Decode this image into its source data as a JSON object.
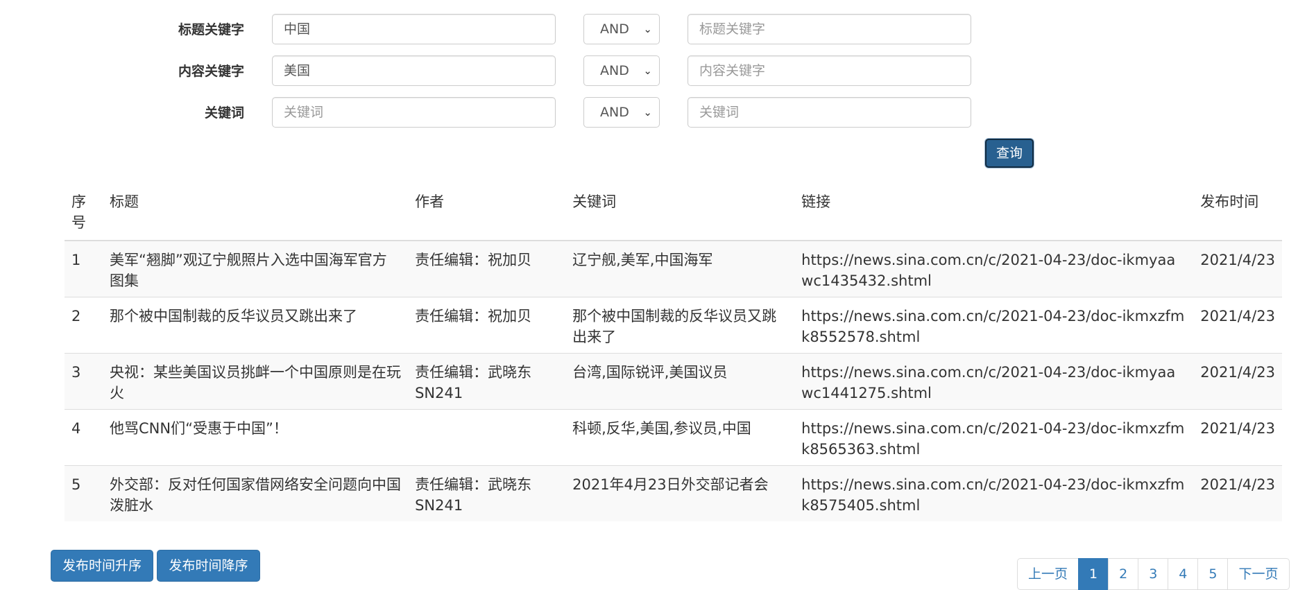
{
  "search": {
    "rows": [
      {
        "label": "标题关键字",
        "value1": "中国",
        "placeholder1": "标题关键字",
        "operator": "AND",
        "value2": "",
        "placeholder2": "标题关键字"
      },
      {
        "label": "内容关键字",
        "value1": "美国",
        "placeholder1": "内容关键字",
        "operator": "AND",
        "value2": "",
        "placeholder2": "内容关键字"
      },
      {
        "label": "关键词",
        "value1": "",
        "placeholder1": "关键词",
        "operator": "AND",
        "value2": "",
        "placeholder2": "关键词"
      }
    ],
    "query_label": "查询"
  },
  "table": {
    "headers": [
      "序号",
      "标题",
      "作者",
      "关键词",
      "链接",
      "发布时间"
    ],
    "rows": [
      {
        "idx": "1",
        "title": "美军“翘脚”观辽宁舰照片入选中国海军官方图集",
        "author": "责任编辑：祝加贝",
        "keywords": "辽宁舰,美军,中国海军",
        "link": "https://news.sina.com.cn/c/2021-04-23/doc-ikmyaawc1435432.shtml",
        "date": "2021/4/23"
      },
      {
        "idx": "2",
        "title": "那个被中国制裁的反华议员又跳出来了",
        "author": "责任编辑：祝加贝",
        "keywords": "那个被中国制裁的反华议员又跳出来了",
        "link": "https://news.sina.com.cn/c/2021-04-23/doc-ikmxzfmk8552578.shtml",
        "date": "2021/4/23"
      },
      {
        "idx": "3",
        "title": "央视：某些美国议员挑衅一个中国原则是在玩火",
        "author": "责任编辑：武晓东 SN241",
        "keywords": "台湾,国际锐评,美国议员",
        "link": "https://news.sina.com.cn/c/2021-04-23/doc-ikmyaawc1441275.shtml",
        "date": "2021/4/23"
      },
      {
        "idx": "4",
        "title": "他骂CNN们“受惠于中国”！",
        "author": "",
        "keywords": "科顿,反华,美国,参议员,中国",
        "link": "https://news.sina.com.cn/c/2021-04-23/doc-ikmxzfmk8565363.shtml",
        "date": "2021/4/23"
      },
      {
        "idx": "5",
        "title": "外交部：反对任何国家借网络安全问题向中国泼脏水",
        "author": "责任编辑：武晓东 SN241",
        "keywords": "2021年4月23日外交部记者会",
        "link": "https://news.sina.com.cn/c/2021-04-23/doc-ikmxzfmk8575405.shtml",
        "date": "2021/4/23"
      }
    ]
  },
  "sort": {
    "asc_label": "发布时间升序",
    "desc_label": "发布时间降序"
  },
  "pagination": {
    "prev_label": "上一页",
    "pages": [
      "1",
      "2",
      "3",
      "4",
      "5"
    ],
    "active_page": "1",
    "next_label": "下一页"
  },
  "colors": {
    "primary": "#337ab7",
    "primary_dark": "#286090",
    "border": "#dddddd",
    "stripe": "#f9f9f9"
  }
}
